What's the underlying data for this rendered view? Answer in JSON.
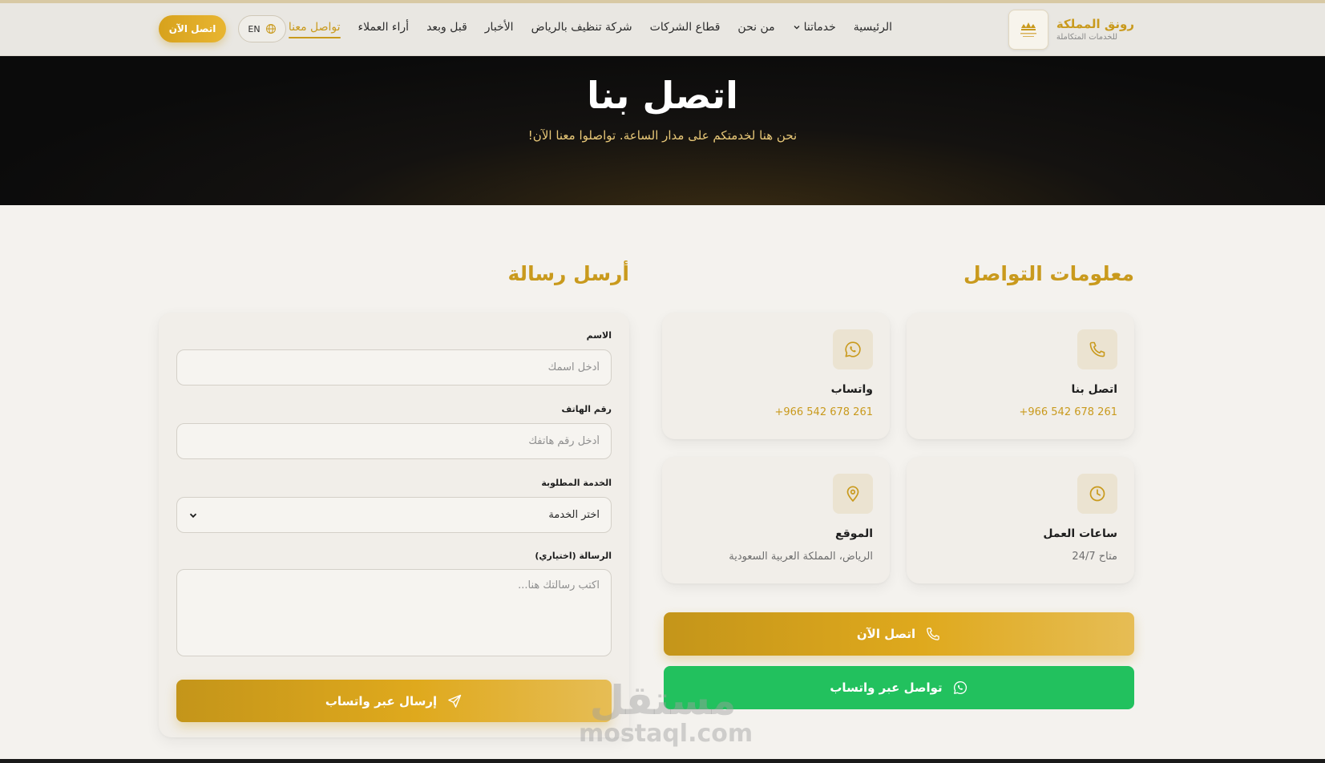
{
  "brand": {
    "name": "رونق المملكة",
    "tagline": "للخدمات المتكاملة",
    "accent_color": "#c99a1d"
  },
  "nav": {
    "items": [
      {
        "label": "الرئيسية"
      },
      {
        "label": "خدماتنا"
      },
      {
        "label": "من نحن"
      },
      {
        "label": "قطاع الشركات"
      },
      {
        "label": "شركة تنظيف بالرياض"
      },
      {
        "label": "الأخبار"
      },
      {
        "label": "قبل وبعد"
      },
      {
        "label": "أراء العملاء"
      },
      {
        "label": "تواصل معنا"
      }
    ],
    "active": "تواصل معنا",
    "lang_label": "EN",
    "cta_label": "اتصل الآن"
  },
  "hero": {
    "title": "اتصل بنا",
    "subtitle": "نحن هنا لخدمتكم على مدار الساعة. تواصلوا معنا الآن!"
  },
  "info": {
    "title": "معلومات التواصل",
    "cards": {
      "phone": {
        "title": "اتصل بنا",
        "value": "+966 542 678 261",
        "icon": "phone-icon"
      },
      "whatsapp": {
        "title": "واتساب",
        "value": "+966 542 678 261",
        "icon": "whatsapp-icon"
      },
      "hours": {
        "title": "ساعات العمل",
        "value": "متاح 24/7",
        "icon": "clock-icon"
      },
      "location": {
        "title": "الموقع",
        "value": "الرياض، المملكة العربية السعودية",
        "icon": "map-pin-icon"
      }
    },
    "call_button": "اتصل الآن",
    "whatsapp_button": "تواصل عبر واتساب",
    "whatsapp_color": "#22c15e"
  },
  "form": {
    "title": "أرسل رسالة",
    "name_label": "الاسم",
    "name_placeholder": "أدخل اسمك",
    "phone_label": "رقم الهاتف",
    "phone_placeholder": "أدخل رقم هاتفك",
    "service_label": "الخدمة المطلوبة",
    "service_selected": "اختر الخدمة",
    "message_label": "الرسالة (اختياري)",
    "message_placeholder": "اكتب رسالتك هنا...",
    "submit_label": "إرسال عبر واتساب"
  },
  "watermark": {
    "arabic": "مستقل",
    "latin": "mostaql.com"
  }
}
